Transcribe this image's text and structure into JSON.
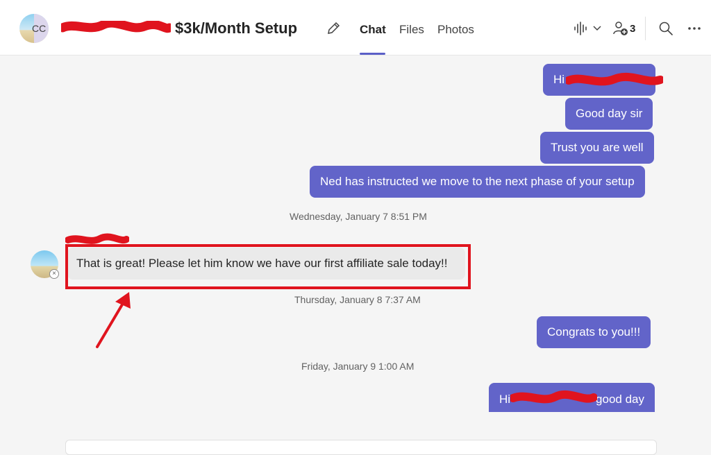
{
  "header": {
    "title": "$3k/Month Setup",
    "avatar_initials": "CC",
    "participant_count": "3",
    "tabs": [
      {
        "label": "Chat",
        "active": true
      },
      {
        "label": "Files",
        "active": false
      },
      {
        "label": "Photos",
        "active": false
      }
    ],
    "icons": [
      "edit-icon",
      "call-icon",
      "chevron-down-icon",
      "people-add-icon",
      "search-icon",
      "more-icon"
    ]
  },
  "messages": {
    "outgoing_1": "Hi",
    "outgoing_2": "Good day sir",
    "outgoing_3": "Trust you are well",
    "outgoing_4": "Ned has instructed we move to the next phase of your setup",
    "timestamp_1": "Wednesday, January 7 8:51 PM",
    "incoming_1": "That is great! Please let him know we have our first affiliate sale today!!",
    "timestamp_2": "Thursday, January 8 7:37 AM",
    "outgoing_5": "Congrats to you!!!",
    "timestamp_3": "Friday, January 9 1:00 AM",
    "outgoing_6_start": "Hi",
    "outgoing_6_end": "good day"
  },
  "colors": {
    "accent": "#6264c9",
    "tab_underline": "#5b5fc7",
    "annotation_red": "#e0141e"
  }
}
